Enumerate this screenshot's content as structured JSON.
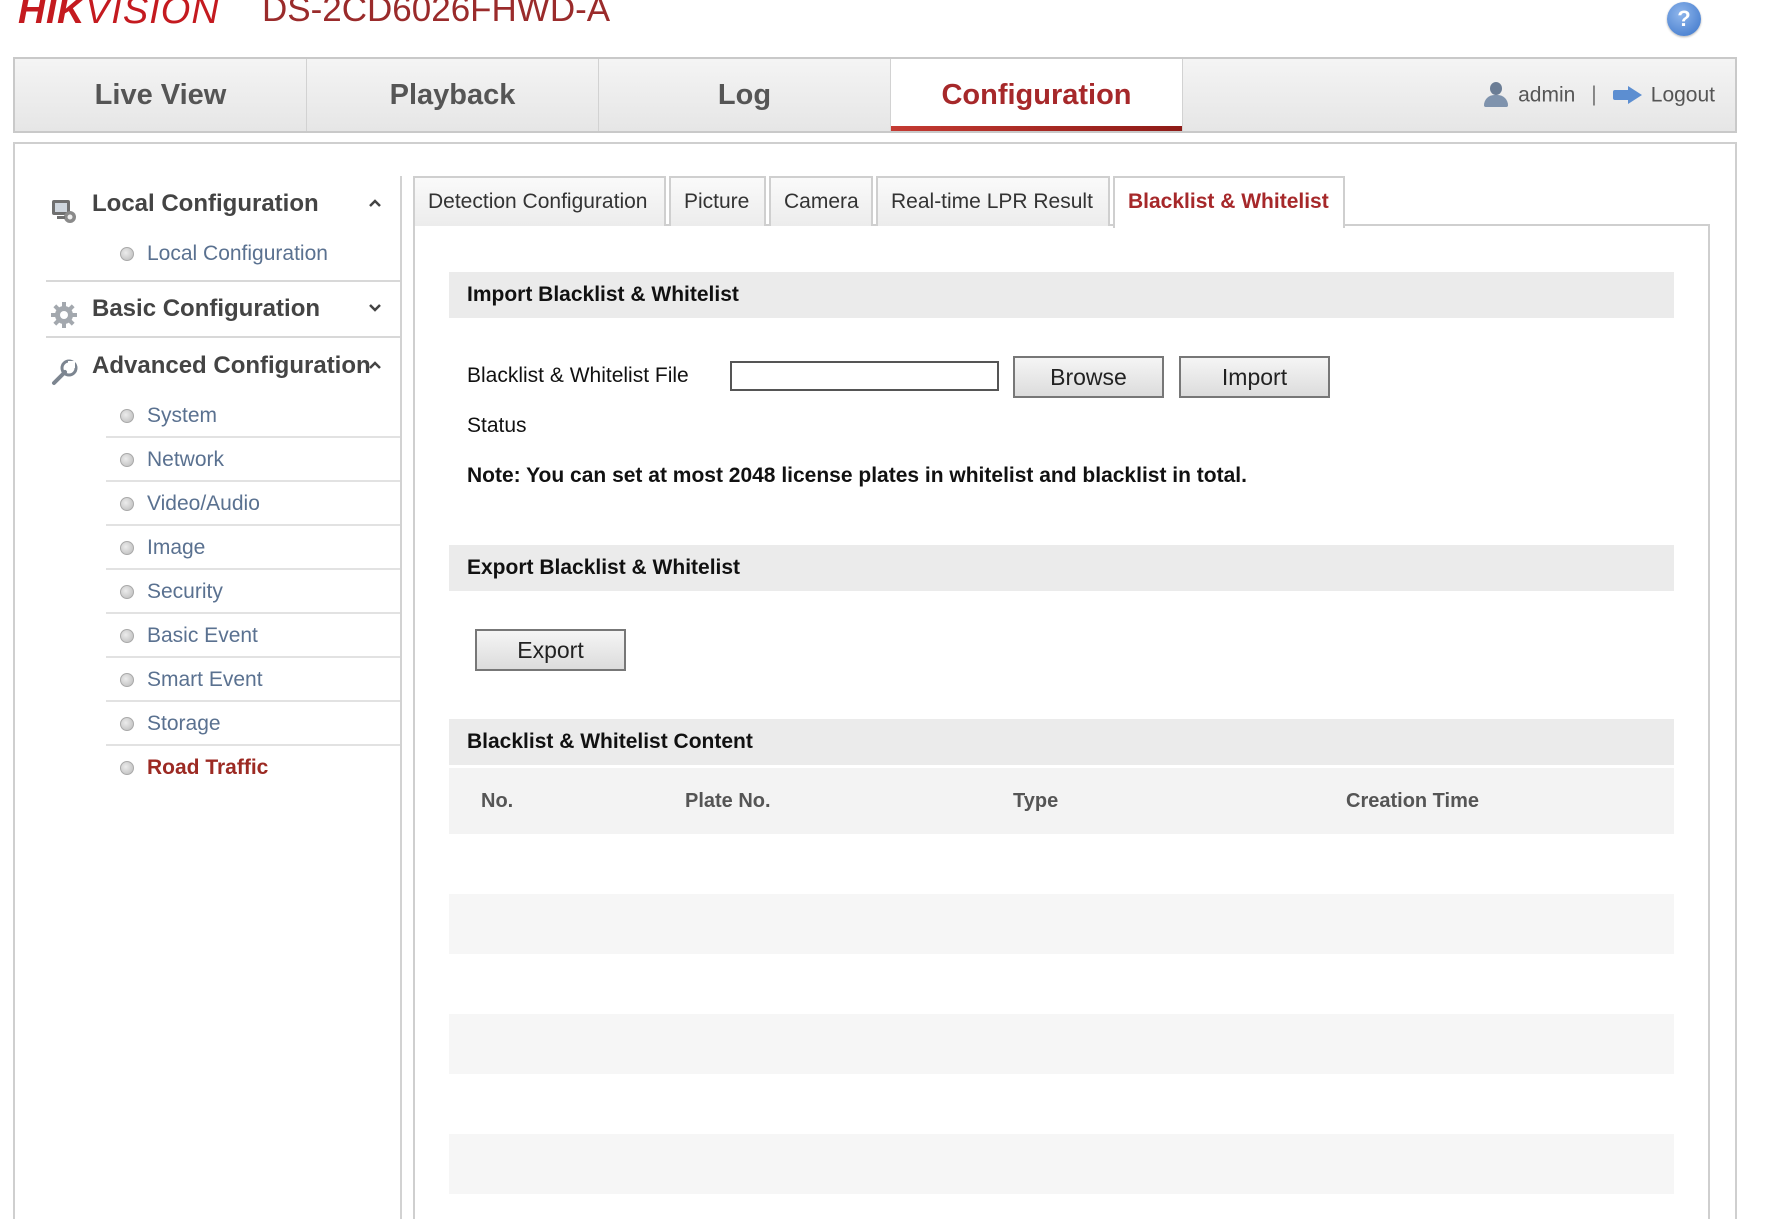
{
  "header": {
    "logo_bold": "HIK",
    "logo_rest": "VISION",
    "model": "DS-2CD6026FHWD-A",
    "help_icon": "?"
  },
  "topnav": {
    "tabs": [
      {
        "label": "Live View",
        "active": false
      },
      {
        "label": "Playback",
        "active": false
      },
      {
        "label": "Log",
        "active": false
      },
      {
        "label": "Configuration",
        "active": true
      }
    ],
    "user": "admin",
    "separator": "|",
    "logout": "Logout"
  },
  "sidebar": {
    "local": {
      "title": "Local Configuration",
      "chevron": "^",
      "items": [
        "Local Configuration"
      ]
    },
    "basic": {
      "title": "Basic Configuration",
      "chevron": "v"
    },
    "advanced": {
      "title": "Advanced Configuration",
      "chevron": "^",
      "items": [
        "System",
        "Network",
        "Video/Audio",
        "Image",
        "Security",
        "Basic Event",
        "Smart Event",
        "Storage",
        "Road Traffic"
      ],
      "active_item": "Road Traffic"
    }
  },
  "subtabs": [
    {
      "label": "Detection Configuration",
      "active": false
    },
    {
      "label": "Picture",
      "active": false
    },
    {
      "label": "Camera",
      "active": false
    },
    {
      "label": "Real-time LPR Result",
      "active": false
    },
    {
      "label": "Blacklist & Whitelist",
      "active": true
    }
  ],
  "import_section": {
    "title": "Import Blacklist & Whitelist",
    "file_label": "Blacklist & Whitelist File",
    "file_value": "",
    "browse_label": "Browse",
    "import_label": "Import",
    "status_label": "Status",
    "note": "Note:  You can set at most 2048 license plates in whitelist and blacklist in total."
  },
  "export_section": {
    "title": "Export Blacklist & Whitelist",
    "export_label": "Export"
  },
  "content_section": {
    "title": "Blacklist & Whitelist Content",
    "columns": [
      "No.",
      "Plate No.",
      "Type",
      "Creation Time"
    ],
    "rows": []
  },
  "colors": {
    "brand": "#c41a1f",
    "active_tab": "#a6282a",
    "link": "#5a7190"
  }
}
